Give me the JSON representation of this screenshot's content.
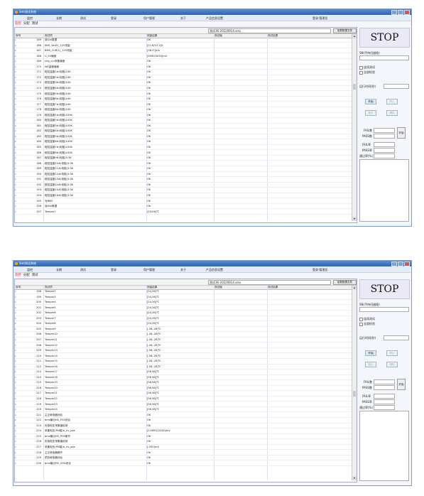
{
  "windows": [
    {
      "title": "Smt测试系统",
      "menu": [
        "监控",
        "长期",
        "测试",
        "登录",
        "用户管理",
        "关于",
        "产品信息设置"
      ],
      "login_text": "登录:管理员",
      "tabs": [
        "监控",
        "分配",
        "测试"
      ],
      "active_tab_index": 0,
      "file_value": "测试36-20220914.xlsx",
      "sample_button": "加载数据文件",
      "columns": [
        "序号",
        "测试项",
        "测量结果",
        "测试值",
        "测试结果"
      ],
      "rows": [
        [
          "169",
          "读Gre数据",
          "OK"
        ],
        [
          "166",
          "KDS_Vol(5)_12V测量",
          "[11.8/12.2]V"
        ],
        [
          "167",
          "BMS_CUR(1)_12V测量",
          "[3817]mA"
        ],
        [
          "168",
          "U_5V偏差",
          "[4950/5050]mV"
        ],
        [
          "169",
          "chg_cur采集偏差",
          "OK"
        ],
        [
          "170",
          "WE量程偏差",
          "OK"
        ],
        [
          "171",
          "程控温度1#(电阻)10K",
          "OK"
        ],
        [
          "172",
          "程控温度2#(电阻)10K",
          "OK"
        ],
        [
          "173",
          "程控温度3#(电阻)10K",
          "OK"
        ],
        [
          "174",
          "程控温度4#(电阻)10K",
          "OK"
        ],
        [
          "175",
          "程控温度5#(电阻)10K",
          "OK"
        ],
        [
          "176",
          "程控温度6#(电阻)10K",
          "OK"
        ],
        [
          "177",
          "程控温度7#(电阻)10K",
          "OK"
        ],
        [
          "178",
          "程控温度8#(电阻)10K",
          "OK"
        ],
        [
          "179",
          "程控温度1#(电阻)100K",
          "OK"
        ],
        [
          "180",
          "程控温度2#(电阻)100K",
          "OK"
        ],
        [
          "181",
          "程控温度3#(电阻)100K",
          "OK"
        ],
        [
          "182",
          "程控温度4#(电阻)100K",
          "OK"
        ],
        [
          "183",
          "程控温度5#(电阻)100K",
          "OK"
        ],
        [
          "184",
          "程控温度6#(电阻)100K",
          "OK"
        ],
        [
          "185",
          "程控温度7#(电阻)100K",
          "OK"
        ],
        [
          "186",
          "程控温度8#(电阻)100K",
          "OK"
        ],
        [
          "187",
          "程控温度9#(电阻)3.3K",
          "OK"
        ],
        [
          "188",
          "程控温度10#(电阻)3.3K",
          "OK"
        ],
        [
          "189",
          "程控温度11#(电阻)3.3K",
          "OK"
        ],
        [
          "190",
          "程控温度12#(电阻)3.3K",
          "OK"
        ],
        [
          "191",
          "程控温度13#(电阻)3.3K",
          "OK"
        ],
        [
          "192",
          "程控温度14#(电阻)3.3K",
          "OK"
        ],
        [
          "193",
          "程控温度15#(电阻)3.3K",
          "OK"
        ],
        [
          "194",
          "程控温度16#(电阻)3.3K",
          "OK"
        ],
        [
          "195",
          "写BMS",
          "OK"
        ],
        [
          "196",
          "读Gre数据",
          "OK"
        ],
        [
          "197",
          "Temper1",
          "[25/26]℃"
        ]
      ],
      "side": {
        "stop": "STOP",
        "sn_label": "SN(手持扫描枪)",
        "check1": "连续测试",
        "check2": "全部检验",
        "cycle_label": "运行时间(秒)",
        "start": "开始",
        "stop_btn": "停止",
        "reset": "复位",
        "clear": "清除",
        "fail_label": "FAIL数",
        "pass_label": "PASS数",
        "test_btn": "开始",
        "fail2": "FAIL率",
        "pass2": "PASS率",
        "rate": "通过率(%)"
      }
    },
    {
      "title": "Smt测试系统",
      "menu": [
        "监控",
        "长期",
        "测试",
        "登录",
        "用户管理",
        "关于",
        "产品信息设置"
      ],
      "login_text": "登录:管理员",
      "tabs": [
        "监控",
        "分配",
        "测试"
      ],
      "active_tab_index": 0,
      "file_value": "测试36-20220914.xlsx",
      "sample_button": "加载数据文件",
      "columns": [
        "序号",
        "测试项",
        "测量结果",
        "测试值",
        "测试结果"
      ],
      "rows": [
        [
          "198",
          "Temper2",
          "[24,26]℃"
        ],
        [
          "199",
          "Temper3",
          "[24,26]℃"
        ],
        [
          "200",
          "Temper4",
          "[24,26]℃"
        ],
        [
          "201",
          "Temper5",
          "[24,26]℃"
        ],
        [
          "202",
          "Temper6",
          "[24,26]℃"
        ],
        [
          "203",
          "Temper7",
          "[24,26]℃"
        ],
        [
          "204",
          "Temper8",
          "[24,26]℃"
        ],
        [
          "205",
          "Temper9",
          "[-26,-26]℃"
        ],
        [
          "206",
          "Temper10",
          "[-26,-26]℃"
        ],
        [
          "207",
          "Temper11",
          "[-26,-26]℃"
        ],
        [
          "208",
          "Temper12",
          "[-26,-26]℃"
        ],
        [
          "209",
          "Temper13",
          "[-26,-26]℃"
        ],
        [
          "210",
          "Temper14",
          "[-26,-26]℃"
        ],
        [
          "211",
          "Temper15",
          "[-26,-26]℃"
        ],
        [
          "212",
          "Temper16",
          "[-26,-26]℃"
        ],
        [
          "213",
          "Temper17",
          "[56,58]℃"
        ],
        [
          "214",
          "Temper18",
          "[56,58]℃"
        ],
        [
          "215",
          "Temper19",
          "[56,58]℃"
        ],
        [
          "216",
          "Temper20",
          "[56,58]℃"
        ],
        [
          "217",
          "Temper21",
          "[56,58]℃"
        ],
        [
          "218",
          "Temper22",
          "[56,58]℃"
        ],
        [
          "219",
          "Temper23",
          "[56,58]℃"
        ],
        [
          "220",
          "Temper24",
          "[56,58]℃"
        ],
        [
          "221",
          "主正继电器闭合",
          "OK"
        ],
        [
          "222",
          "bms输出HS_POS闭合",
          "OK"
        ],
        [
          "223",
          "负极电压采集值检测",
          "OK"
        ],
        [
          "224",
          "采集电压(PN端)U_hv_pos",
          "[11980/12200]mV"
        ],
        [
          "225",
          "bms输出HS_POS断开",
          "OK"
        ],
        [
          "226",
          "负极电压采集值检测",
          "OK"
        ],
        [
          "227",
          "采集电压(PN端)U_hv_pos",
          "[-200]mV"
        ],
        [
          "228",
          "主正继电器断开",
          "OK"
        ],
        [
          "229",
          "预充继电器闭合",
          "OK"
        ],
        [
          "230",
          "bms输出HS_CHG闭合",
          "OK"
        ]
      ],
      "side": {
        "stop": "STOP",
        "sn_label": "SN(手持扫描枪)",
        "check1": "连续测试",
        "check2": "全部检验",
        "cycle_label": "运行时间(秒)",
        "start": "开始",
        "stop_btn": "停止",
        "reset": "复位",
        "clear": "清除",
        "fail_label": "FAIL数",
        "pass_label": "PASS数",
        "test_btn": "开始",
        "fail2": "FAIL率",
        "pass2": "PASS率",
        "rate": "通过率(%)"
      }
    }
  ]
}
